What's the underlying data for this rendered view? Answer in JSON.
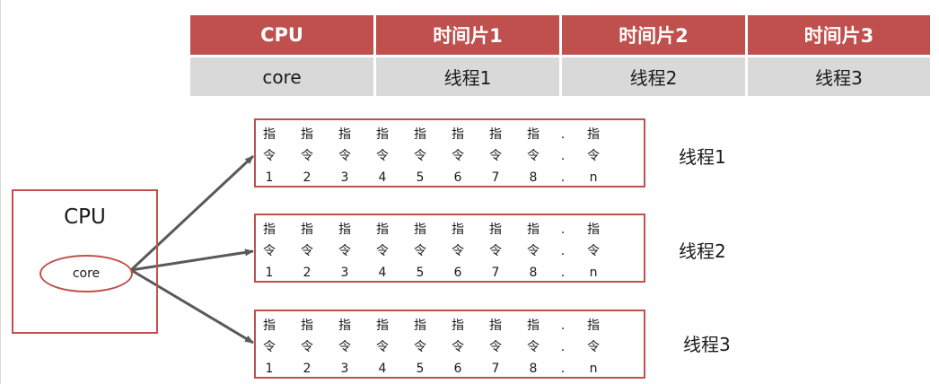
{
  "table": {
    "header": [
      "CPU",
      "时间片1",
      "时间片2",
      "时间片3"
    ],
    "row": [
      "core",
      "线程1",
      "线程2",
      "线程3"
    ]
  },
  "cpu": {
    "label": "CPU",
    "core_label": "core"
  },
  "instruction": {
    "line1": "指",
    "line2": "令",
    "numbers": [
      "1",
      "2",
      "3",
      "4",
      "5",
      "6",
      "7",
      "8",
      ".",
      "n"
    ],
    "separator": "."
  },
  "threads": [
    {
      "label": "线程1"
    },
    {
      "label": "线程2"
    },
    {
      "label": "线程3"
    }
  ],
  "colors": {
    "accent": "#c0504d",
    "table_body": "#d9d9d9",
    "arrow": "#595959"
  }
}
